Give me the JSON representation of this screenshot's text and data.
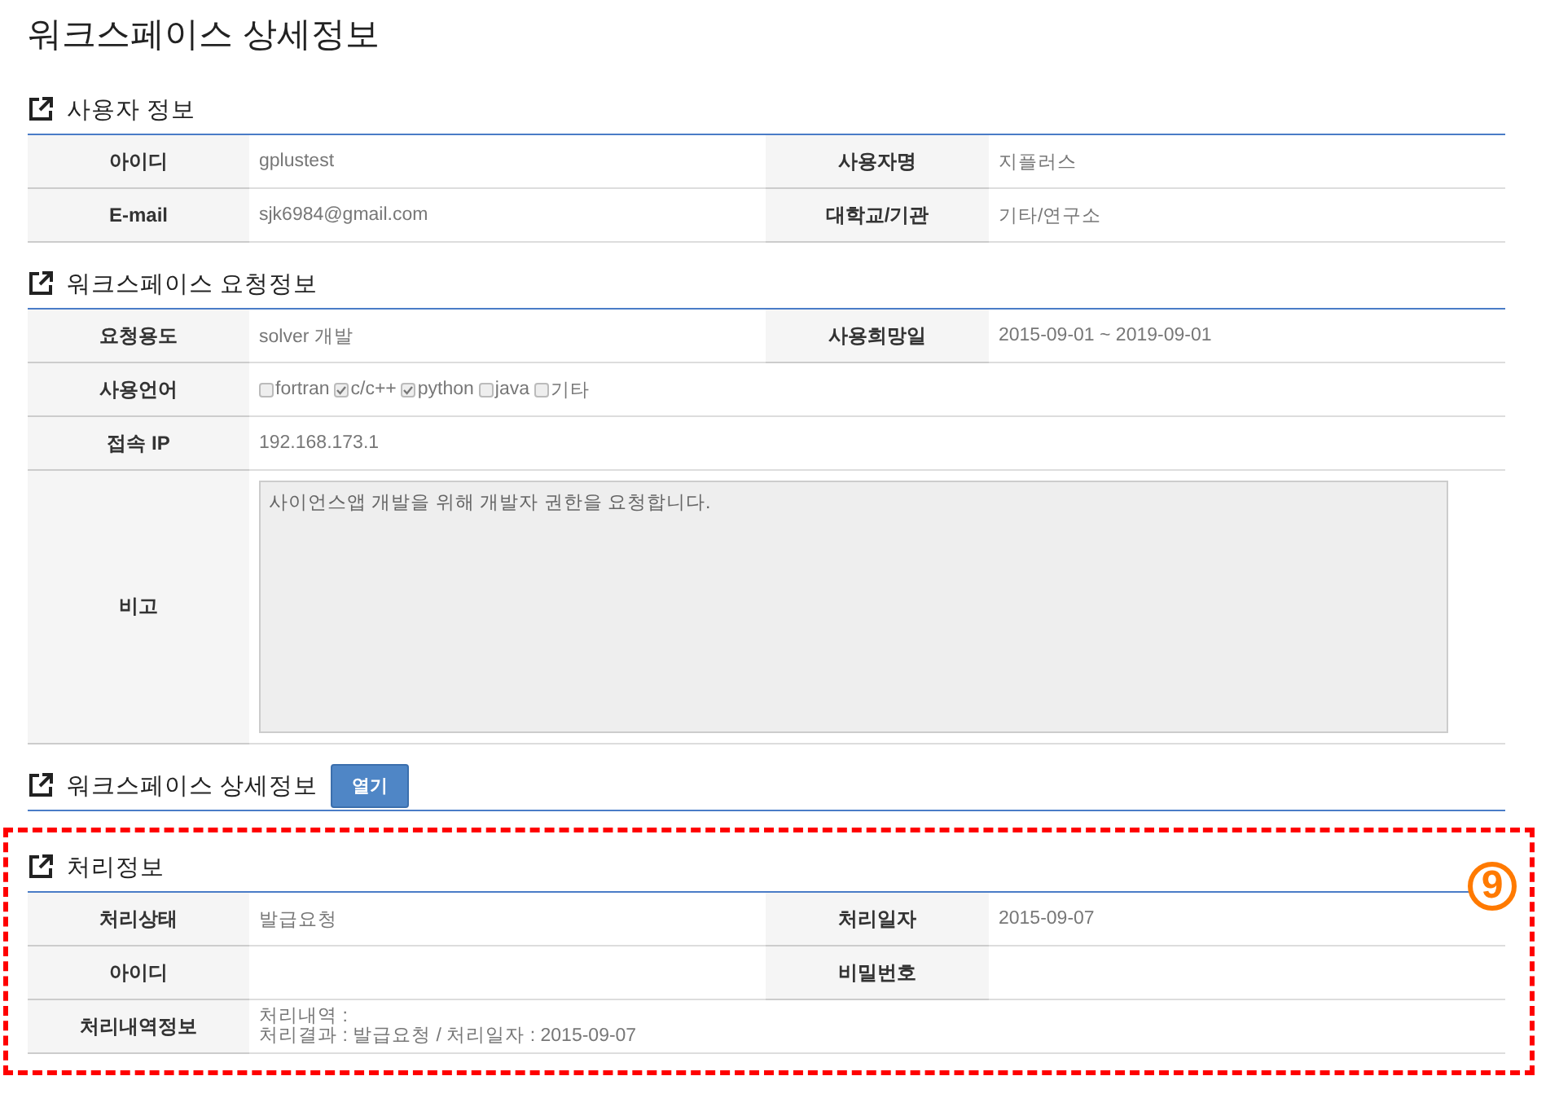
{
  "page_title": "워크스페이스 상세정보",
  "sections": [
    {
      "title": "사용자 정보",
      "rows": [
        {
          "kind": "pair",
          "cells": [
            {
              "label": "아이디",
              "value": "gplustest"
            },
            {
              "label": "사용자명",
              "value": "지플러스"
            }
          ]
        },
        {
          "kind": "pair",
          "cells": [
            {
              "label": "E-mail",
              "value": "sjk6984@gmail.com"
            },
            {
              "label": "대학교/기관",
              "value": "기타/연구소"
            }
          ]
        }
      ]
    },
    {
      "title": "워크스페이스 요청정보",
      "rows": [
        {
          "kind": "pair",
          "cells": [
            {
              "label": "요청용도",
              "value": "solver 개발"
            },
            {
              "label": "사용희망일",
              "value": "2015-09-01 ~ 2019-09-01"
            }
          ]
        },
        {
          "kind": "checkboxes",
          "label": "사용언어",
          "options": [
            {
              "label": "fortran",
              "checked": false
            },
            {
              "label": "c/c++",
              "checked": true
            },
            {
              "label": "python",
              "checked": true
            },
            {
              "label": "java",
              "checked": false
            },
            {
              "label": "기타",
              "checked": false
            }
          ]
        },
        {
          "kind": "single",
          "label": "접속 IP",
          "value": "192.168.173.1"
        },
        {
          "kind": "textarea",
          "label": "비고",
          "value": "사이언스앱 개발을 위해 개발자 권한을 요청합니다."
        }
      ]
    },
    {
      "title": "워크스페이스 상세정보",
      "button": "열기"
    },
    {
      "title": "처리정보",
      "highlighted": true,
      "callout": "9",
      "rows": [
        {
          "kind": "pair",
          "cells": [
            {
              "label": "처리상태",
              "value": "발급요청"
            },
            {
              "label": "처리일자",
              "value": "2015-09-07"
            }
          ]
        },
        {
          "kind": "pair",
          "cells": [
            {
              "label": "아이디"
            },
            {
              "label": "비밀번호"
            }
          ]
        },
        {
          "kind": "lines",
          "label": "처리내역정보",
          "lines": [
            "처리내역 :",
            "처리결과 : 발급요청 / 처리일자 : 2015-09-07"
          ]
        }
      ]
    }
  ]
}
